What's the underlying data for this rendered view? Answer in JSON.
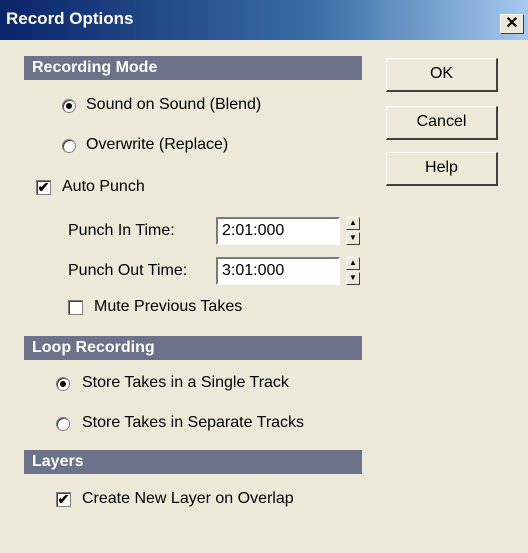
{
  "window": {
    "title": "Record Options",
    "close_label": "✕"
  },
  "recording_mode": {
    "header": "Recording Mode",
    "options": [
      {
        "label": "Sound on Sound (Blend)",
        "selected": true
      },
      {
        "label": "Overwrite (Replace)",
        "selected": false
      }
    ]
  },
  "auto_punch": {
    "label": "Auto Punch",
    "checked": true,
    "punch_in": {
      "label": "Punch In Time:",
      "value": "2:01:000"
    },
    "punch_out": {
      "label": "Punch Out Time:",
      "value": "3:01:000"
    },
    "mute_previous": {
      "label": "Mute Previous Takes",
      "checked": false
    }
  },
  "loop_recording": {
    "header": "Loop Recording",
    "options": [
      {
        "label": "Store Takes in a Single Track",
        "selected": true
      },
      {
        "label": "Store Takes in Separate Tracks",
        "selected": false
      }
    ]
  },
  "layers": {
    "header": "Layers",
    "create_new_layer": {
      "label": "Create New Layer on Overlap",
      "checked": true
    }
  },
  "buttons": {
    "ok": "OK",
    "cancel": "Cancel",
    "help": "Help"
  }
}
